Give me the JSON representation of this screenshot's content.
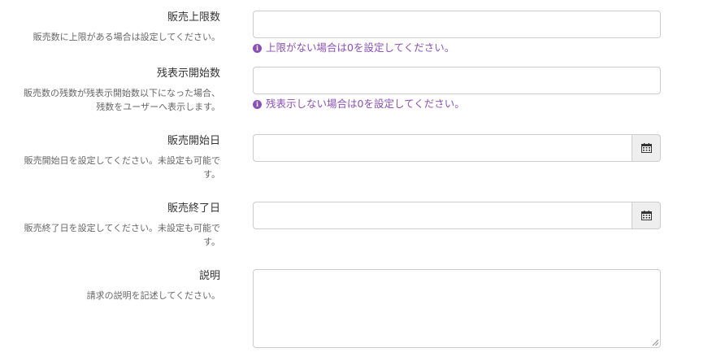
{
  "fields": {
    "sales_limit": {
      "label": "販売上限数",
      "description": "販売数に上限がある場合は設定してください。",
      "value": "",
      "help": "上限がない場合は0を設定してください。"
    },
    "remaining_display": {
      "label": "残表示開始数",
      "description_line1": "販売数の残数が残表示開始数以下になった場合、",
      "description_line2": "残数をユーザーへ表示します。",
      "value": "",
      "help": "残表示しない場合は0を設定してください。"
    },
    "sales_start": {
      "label": "販売開始日",
      "description_line1": "販売開始日を設定してください。未設定も可能で",
      "description_line2": "す。",
      "value": ""
    },
    "sales_end": {
      "label": "販売終了日",
      "description_line1": "販売終了日を設定してください。未設定も可能で",
      "description_line2": "す。",
      "value": ""
    },
    "explanation": {
      "label": "説明",
      "description": "請求の説明を記述してください。",
      "value": ""
    }
  },
  "icons": {
    "info": "info-circle-icon",
    "calendar": "calendar-icon"
  },
  "colors": {
    "help_text": "#8a4fb8",
    "border": "#cccccc",
    "addon_bg": "#eeeeee"
  }
}
